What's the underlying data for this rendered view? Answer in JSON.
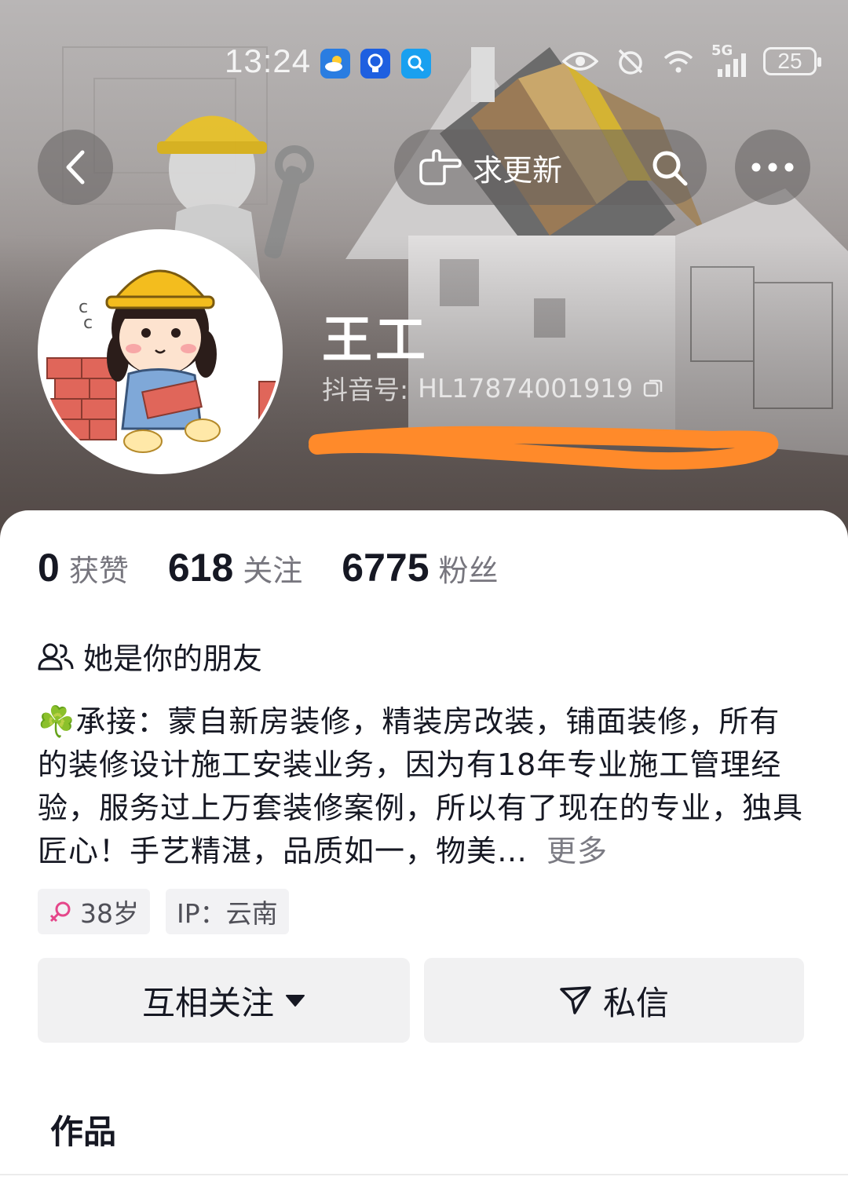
{
  "status_bar": {
    "time": "13:24",
    "network": "5G",
    "battery": "25",
    "app_icons": [
      "weather-icon",
      "bulb-icon",
      "search-app-icon"
    ],
    "right_icons": [
      "eye-icon",
      "alarm-icon",
      "wifi-icon",
      "signal-icon"
    ]
  },
  "nav": {
    "request_update_label": "求更新"
  },
  "profile": {
    "name": "王工",
    "id_label": "抖音号:",
    "id_value": "HL17874001919"
  },
  "stats": [
    {
      "value": "0",
      "label": "获赞"
    },
    {
      "value": "618",
      "label": "关注"
    },
    {
      "value": "6775",
      "label": "粉丝"
    }
  ],
  "friend_note": "她是你的朋友",
  "bio": {
    "emoji": "☘️",
    "text": "承接：蒙自新房装修，精装房改装，铺面装修，所有的装修设计施工安装业务，因为有18年专业施工管理经验，服务过上万套装修案例，所以有了现在的专业，独具匠心！手艺精湛，品质如一，物美…",
    "more": "更多"
  },
  "tags": {
    "age": "38岁",
    "ip": "IP：云南"
  },
  "actions": {
    "follow_label": "互相关注",
    "message_label": "私信"
  },
  "tabs": {
    "works": "作品"
  },
  "colors": {
    "accent_pink": "#e5478a",
    "scribble_orange": "#ff8a2a",
    "text_primary": "#161823",
    "text_secondary": "#77767e"
  }
}
